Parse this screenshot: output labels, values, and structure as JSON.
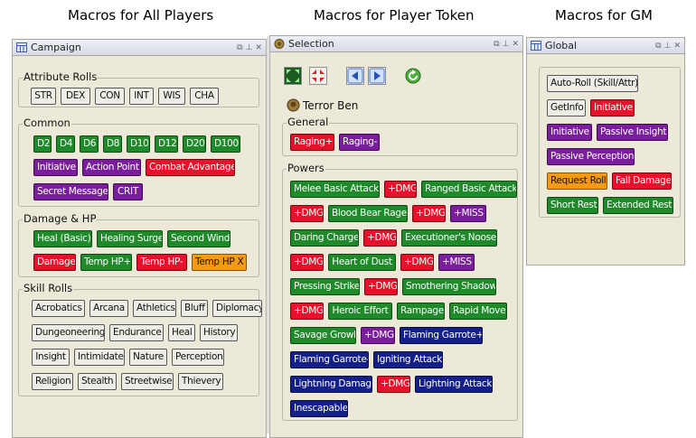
{
  "headings": {
    "all": "Macros for All Players",
    "token": "Macros for Player Token",
    "gm": "Macros for GM"
  },
  "panels": {
    "campaign": {
      "title": "Campaign",
      "groups": [
        {
          "label": "Attribute Rolls",
          "buttons": [
            "STR",
            "DEX",
            "CON",
            "INT",
            "WIS",
            "CHA"
          ]
        },
        {
          "label": "Common",
          "buttons": [
            "D2",
            "D4",
            "D6",
            "D8",
            "D10",
            "D12",
            "D20",
            "D100",
            "Initiative",
            "Action Point",
            "Combat Advantage",
            "Secret Message",
            "CRIT"
          ]
        },
        {
          "label": "Damage & HP",
          "buttons": [
            "Heal (Basic)",
            "Healing Surge",
            "Second Wind",
            "Damage",
            "Temp HP+",
            "Temp HP-",
            "Temp HP X"
          ]
        },
        {
          "label": "Skill Rolls",
          "buttons": [
            "Acrobatics",
            "Arcana",
            "Athletics",
            "Bluff",
            "Diplomacy",
            "Dungeoneering",
            "Endurance",
            "Heal",
            "History",
            "Insight",
            "Intimidate",
            "Nature",
            "Perception",
            "Religion",
            "Stealth",
            "Streetwise",
            "Thievery"
          ]
        }
      ]
    },
    "selection": {
      "title": "Selection",
      "token_name": "Terror Ben",
      "groups": [
        {
          "label": "General",
          "buttons": [
            "Raging+",
            "Raging-"
          ]
        },
        {
          "label": "Powers",
          "buttons": [
            "Melee Basic Attack",
            "+DMG",
            "Ranged Basic Attack",
            "+DMG",
            "Blood Bear Rage",
            "+DMG",
            "+MISS",
            "Daring Charge",
            "+DMG",
            "Executioner's Noose",
            "+DMG",
            "Heart of Dust",
            "+DMG",
            "+MISS",
            "Pressing Strike",
            "+DMG",
            "Smothering Shadow",
            "+DMG",
            "Heroic Effort",
            "Rampage",
            "Rapid Move",
            "Savage Growl",
            "+DMG",
            "Flaming Garrote+",
            "Flaming Garrote-",
            "Igniting Attack",
            "Lightning Damage",
            "+DMG",
            "Lightning Attack",
            "Inescapable"
          ]
        }
      ]
    },
    "global": {
      "title": "Global",
      "buttons": [
        "Auto-Roll (Skill/Attr)",
        "GetInfo",
        "Initiative",
        "Initiative",
        "Passive Insight",
        "Passive Perception",
        "Request Roll",
        "Fall Damage",
        "Short Rest",
        "Extended Rest"
      ]
    }
  },
  "colors": {
    "green": "#1f8a2a",
    "purple": "#7a1e9e",
    "red": "#e8102a",
    "orange": "#f59a12",
    "navy": "#14208a",
    "plain": "#eeede5",
    "panel": "#ece9d8"
  }
}
